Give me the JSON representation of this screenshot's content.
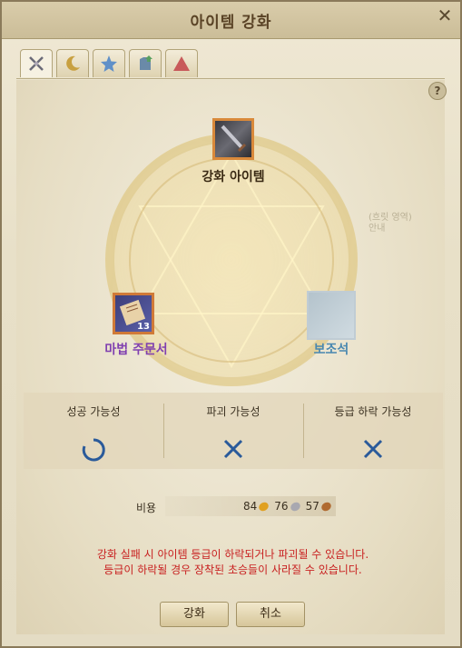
{
  "window": {
    "title": "아이템 강화",
    "close_glyph": "✕"
  },
  "tabs": [
    {
      "icon": "crossed-swords-icon",
      "active": true
    },
    {
      "icon": "crescent-moon-icon"
    },
    {
      "icon": "star-badge-icon"
    },
    {
      "icon": "armor-upgrade-icon"
    },
    {
      "icon": "triangle-gem-icon"
    }
  ],
  "help_label": "?",
  "slots": {
    "main_item": {
      "label": "강화 아이템",
      "icon": "sword-icon"
    },
    "scroll": {
      "label": "마법 주문서",
      "count": "13",
      "icon": "scroll-icon"
    },
    "auxiliary": {
      "label": "보조석",
      "icon": "empty-slot"
    }
  },
  "faded_text": [
    "(흐릿 영역)",
    "안내"
  ],
  "probabilities": [
    {
      "label": "성공 가능성",
      "indicator": "spinner-ring"
    },
    {
      "label": "파괴 가능성",
      "indicator": "x-mark"
    },
    {
      "label": "등급 하락 가능성",
      "indicator": "x-mark"
    }
  ],
  "cost": {
    "label": "비용",
    "gold": "84",
    "silver": "76",
    "copper": "57",
    "gold_color": "#e0a020",
    "silver_color": "#a8a8b0",
    "copper_color": "#b06a30"
  },
  "warning": {
    "line1": "강화 실패 시 아이템 등급이 하락되거나 파괴될 수 있습니다.",
    "line2": "등급이 하락될 경우 장착된 초승들이 사라질 수 있습니다.",
    "color": "#c82020"
  },
  "buttons": {
    "enhance": "강화",
    "cancel": "취소"
  }
}
